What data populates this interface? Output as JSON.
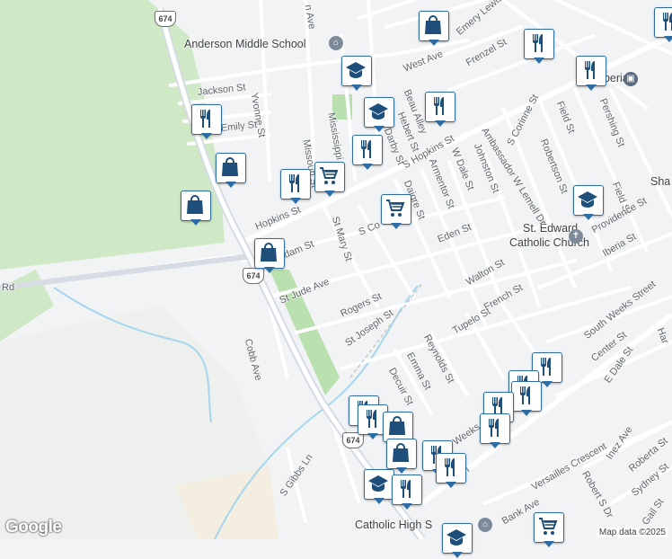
{
  "map": {
    "colors": {
      "land": "#f1f3f4",
      "green": "#c9e7c3",
      "road": "#ffffff",
      "highway": "#d6dce3",
      "water": "#a5d6ee",
      "marker_border": "#2d6da3",
      "marker_icon": "#1d4f7a"
    },
    "labels": {
      "anderson_ms": "Anderson Middle School",
      "catholic_hs": "Catholic High S",
      "st_edward_1": "St. Edward",
      "st_edward_2": "Catholic Church",
      "new_iberia": "New Iberia",
      "sha": "Sha"
    },
    "streets": {
      "jackson": "Jackson St",
      "yvonne": "Yvonne St",
      "emily": "Emily St",
      "mason": "n Ave",
      "mississippi": "Mississippi St",
      "missouri": "Missouri St",
      "hopkins_w": "Hopkins St",
      "hopkins_e": "S Hopkins St",
      "adam": "Adam St",
      "st_mary": "St Mary St",
      "st_jude": "St Jude Ave",
      "rogers": "Rogers St",
      "st_joseph": "St Joseph St",
      "cobb": "Cobb Ave",
      "gibbs": "S Gibbs Ln",
      "s_corinne_w": "S Co",
      "daigre": "Daigre St",
      "armentor": "Armentor St",
      "w_dale": "W Dale St",
      "johnston": "Johnston St",
      "eden": "Eden St",
      "hebert": "Hebert St",
      "darby": "Darby St",
      "beautly": "Beau Alley",
      "west_ave": "West Ave",
      "frenzel": "Frenzel St",
      "emery_lewis": "Emery Lewis Ave",
      "ambassador": "Ambassador W Lemell Dr",
      "s_corinne_e": "S Corinne St",
      "robertson": "Robertson St",
      "field_n": "Field St",
      "pershing": "Pershing St",
      "field_s": "Field St",
      "providence": "Providence St",
      "iberia": "Iberia St",
      "walton": "Walton St",
      "french": "French St",
      "tupelo": "Tupelo St",
      "reynolds": "Reynolds St",
      "emma": "Emma St",
      "decuir": "Decuir St",
      "south_weeks": "South Weeks Street",
      "center": "Center St",
      "e_dale": "E Dale St",
      "versailles": "Versailles Crescent",
      "inez": "Inez Ave",
      "roberta": "Roberta St",
      "robert_s": "Robert S Dr",
      "sydney": "Sydney St",
      "gail": "Gail St",
      "bank": "Bank Ave",
      "weeks": "Weeks St",
      "cen": "Cen",
      "rd": "Rd",
      "har": "Har"
    },
    "shields": [
      "674",
      "674",
      "674"
    ],
    "markers": [
      {
        "icon": "restaurant-icon"
      },
      {
        "icon": "shopping-bag-icon"
      },
      {
        "icon": "school-icon"
      },
      {
        "icon": "school-icon"
      },
      {
        "icon": "restaurant-icon"
      },
      {
        "icon": "restaurant-icon"
      },
      {
        "icon": "restaurant-icon"
      },
      {
        "icon": "restaurant-icon"
      },
      {
        "icon": "shopping-cart-icon"
      },
      {
        "icon": "restaurant-icon"
      },
      {
        "icon": "shopping-bag-icon"
      },
      {
        "icon": "shopping-bag-icon"
      },
      {
        "icon": "shopping-cart-icon"
      },
      {
        "icon": "shopping-bag-icon"
      },
      {
        "icon": "school-icon"
      },
      {
        "icon": "restaurant-icon"
      },
      {
        "icon": "restaurant-icon"
      },
      {
        "icon": "restaurant-icon"
      },
      {
        "icon": "restaurant-icon"
      },
      {
        "icon": "restaurant-icon"
      },
      {
        "icon": "restaurant-icon"
      },
      {
        "icon": "restaurant-icon"
      },
      {
        "icon": "restaurant-icon"
      },
      {
        "icon": "shopping-bag-icon"
      },
      {
        "icon": "shopping-bag-icon"
      },
      {
        "icon": "restaurant-icon"
      },
      {
        "icon": "school-icon"
      },
      {
        "icon": "restaurant-icon"
      },
      {
        "icon": "school-icon"
      },
      {
        "icon": "shopping-cart-icon"
      },
      {
        "icon": "restaurant-icon"
      }
    ],
    "logo": "Google",
    "attribution": "Map data ©2025"
  }
}
